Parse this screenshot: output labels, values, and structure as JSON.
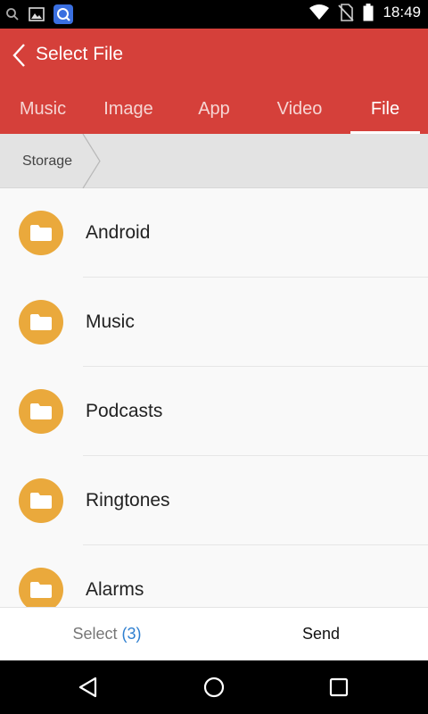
{
  "status_bar": {
    "time": "18:49",
    "left_icons": [
      "search-icon",
      "image-icon",
      "q-app-icon"
    ],
    "right_icons": [
      "wifi-icon",
      "no-sim-icon",
      "battery-icon"
    ]
  },
  "app_bar": {
    "title": "Select File",
    "back_icon": "chevron-left-icon",
    "color": "#d5403a"
  },
  "tabs": [
    {
      "label": "Music",
      "active": false
    },
    {
      "label": "Image",
      "active": false
    },
    {
      "label": "App",
      "active": false
    },
    {
      "label": "Video",
      "active": false
    },
    {
      "label": "File",
      "active": true
    }
  ],
  "breadcrumb": {
    "items": [
      "Storage"
    ]
  },
  "files": [
    {
      "name": "Android",
      "icon": "folder-icon"
    },
    {
      "name": "Music",
      "icon": "folder-icon"
    },
    {
      "name": "Podcasts",
      "icon": "folder-icon"
    },
    {
      "name": "Ringtones",
      "icon": "folder-icon"
    },
    {
      "name": "Alarms",
      "icon": "folder-icon"
    }
  ],
  "bottom_bar": {
    "select_label": "Select",
    "select_count": "(3)",
    "send_label": "Send",
    "count_color": "#2e7fd0"
  },
  "nav_bar": {
    "buttons": [
      "back-triangle-icon",
      "home-circle-icon",
      "recents-square-icon"
    ]
  }
}
